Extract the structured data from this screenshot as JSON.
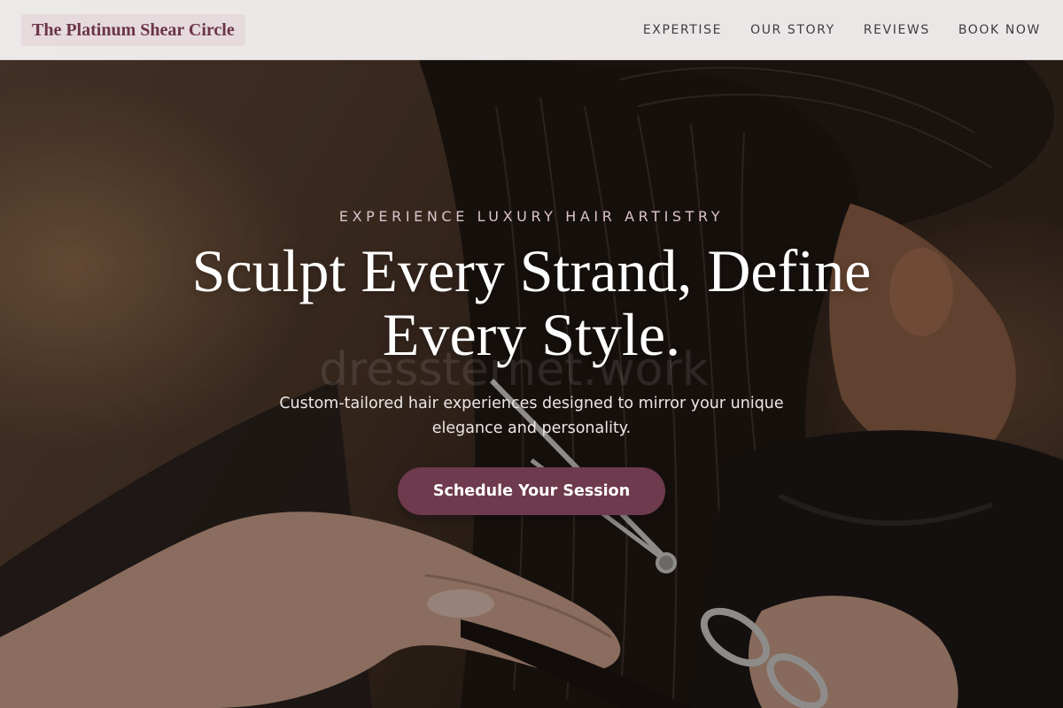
{
  "header": {
    "brand": "The Platinum Shear Circle",
    "nav": [
      {
        "label": "EXPERTISE"
      },
      {
        "label": "OUR STORY"
      },
      {
        "label": "REVIEWS"
      },
      {
        "label": "BOOK NOW"
      }
    ]
  },
  "hero": {
    "eyebrow": "EXPERIENCE LUXURY HAIR ARTISTRY",
    "headline": "Sculpt Every Strand, Define Every Style.",
    "subtitle": "Custom-tailored hair experiences designed to mirror your unique elegance and personality.",
    "cta_label": "Schedule Your Session",
    "watermark": "dressternet.work",
    "image_subject": "stylist cutting long dark wet hair with scissors"
  },
  "colors": {
    "brand_text": "#6b3448",
    "brand_bg": "#e6dadd",
    "accent": "#6e3a4e",
    "eyebrow": "#dcc3cb",
    "header_bg": "#f4f0f0"
  }
}
